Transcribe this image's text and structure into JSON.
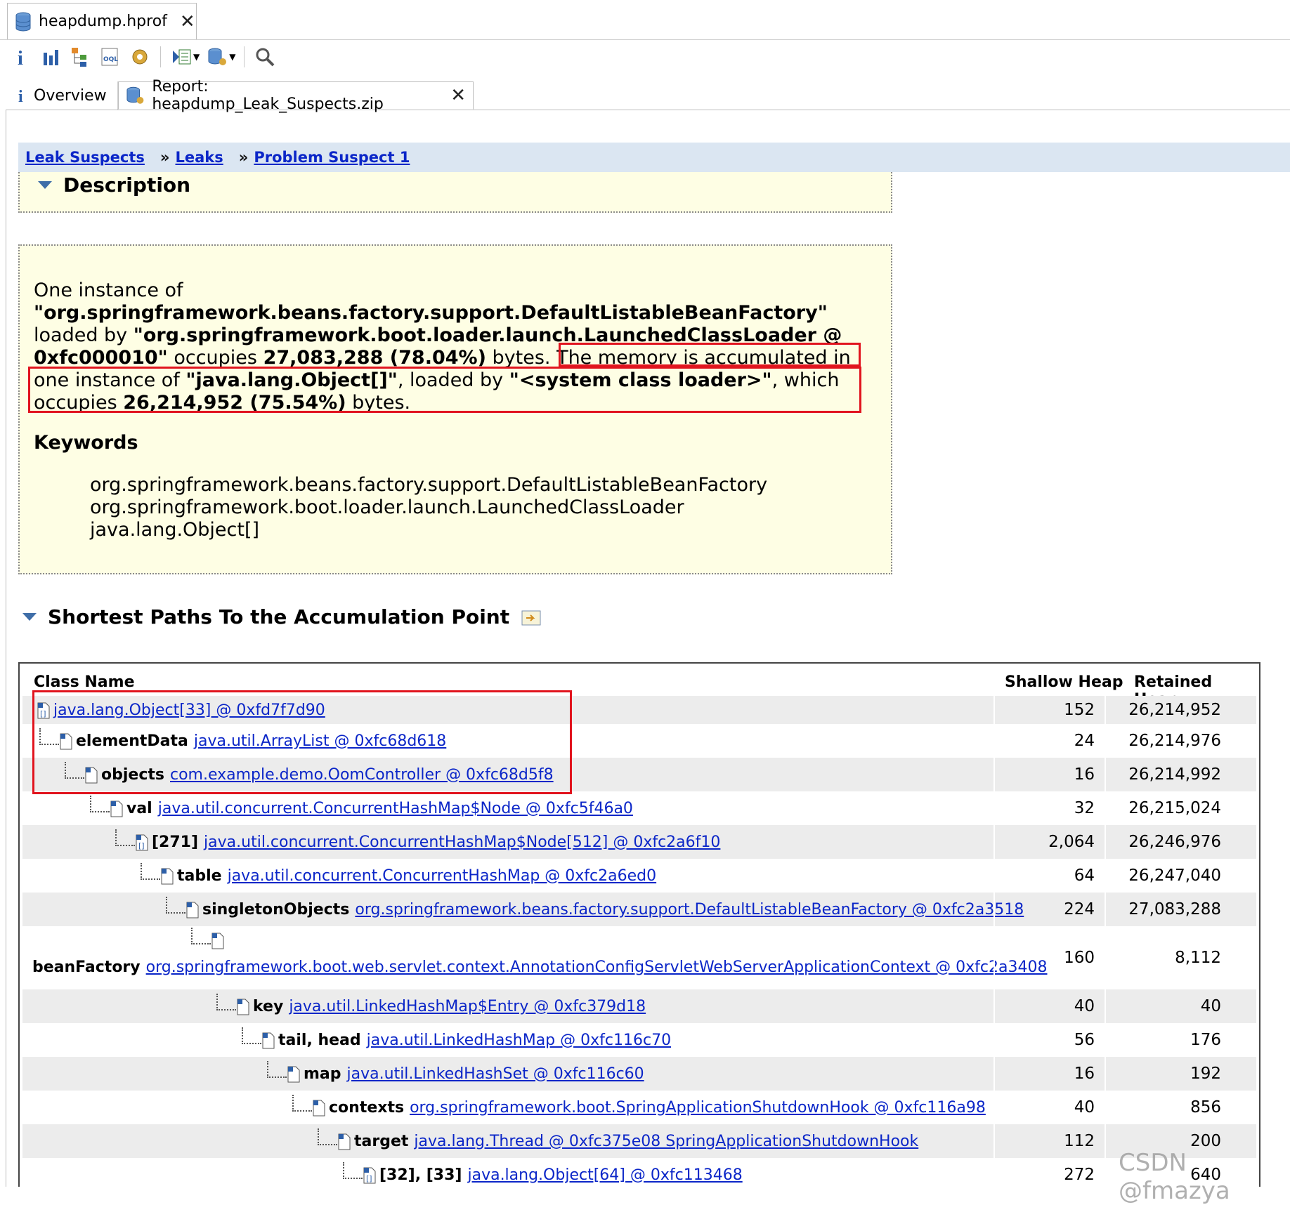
{
  "editor": {
    "tab_title": "heapdump.hprof"
  },
  "toolbar": {
    "icons": [
      "info-icon",
      "histogram-icon",
      "dominator-tree-icon",
      "oql-icon",
      "thread-overview-icon",
      "run-report-icon",
      "query-browser-icon",
      "find-object-icon"
    ]
  },
  "tabs": {
    "overview": "Overview",
    "report": "Report: heapdump_Leak_Suspects.zip"
  },
  "breadcrumb": {
    "items": [
      "Leak Suspects",
      "Leaks",
      "Problem Suspect 1"
    ],
    "separator": "»"
  },
  "description": {
    "heading": "Description",
    "p1": "One instance of",
    "class1": "\"org.springframework.beans.factory.support.DefaultListableBeanFactory\"",
    "loaded_by": "loaded by",
    "loader1": "\"org.springframework.boot.loader.launch.LaunchedClassLoader @",
    "loader1_addr": "0xfc000010\"",
    "occupies": "occupies",
    "size1": "27,083,288 (78.04%)",
    "bytes": "bytes.",
    "accum1": "The memory is accumulated in",
    "accum2": "one instance of",
    "class2": "\"java.lang.Object[]\"",
    "loaded_by2": ", loaded by",
    "loader2": "\"<system class loader>\"",
    "which": ", which",
    "occupies2": "occupies",
    "size2": "26,214,952 (75.54%)",
    "bytes2": "bytes.",
    "keywords_title": "Keywords",
    "keywords": [
      "org.springframework.beans.factory.support.DefaultListableBeanFactory",
      "org.springframework.boot.loader.launch.LaunchedClassLoader",
      "java.lang.Object[]"
    ]
  },
  "paths": {
    "heading": "Shortest Paths To the Accumulation Point",
    "columns": {
      "class_name": "Class Name",
      "shallow": "Shallow Heap",
      "retained": "Retained Heap"
    },
    "rows": [
      {
        "field": "",
        "link": "java.lang.Object[33] @ 0xfd7f7d90",
        "shallow": "152",
        "retained": "26,214,952"
      },
      {
        "field": "elementData",
        "link": "java.util.ArrayList @ 0xfc68d618",
        "shallow": "24",
        "retained": "26,214,976"
      },
      {
        "field": "objects",
        "link": "com.example.demo.OomController @ 0xfc68d5f8",
        "shallow": "16",
        "retained": "26,214,992"
      },
      {
        "field": "val",
        "link": "java.util.concurrent.ConcurrentHashMap$Node @ 0xfc5f46a0",
        "shallow": "32",
        "retained": "26,215,024"
      },
      {
        "field": "[271]",
        "link": "java.util.concurrent.ConcurrentHashMap$Node[512] @ 0xfc2a6f10",
        "shallow": "2,064",
        "retained": "26,246,976"
      },
      {
        "field": "table",
        "link": "java.util.concurrent.ConcurrentHashMap @ 0xfc2a6ed0",
        "shallow": "64",
        "retained": "26,247,040"
      },
      {
        "field": "singletonObjects",
        "link": "org.springframework.beans.factory.support.DefaultListableBeanFactory @ 0xfc2a3518",
        "shallow": "224",
        "retained": "27,083,288"
      },
      {
        "field": "beanFactory",
        "link": "org.springframework.boot.web.servlet.context.AnnotationConfigServletWebServerApplicationContext @ 0xfc2a3408",
        "shallow": "160",
        "retained": "8,112"
      },
      {
        "field": "key",
        "link": "java.util.LinkedHashMap$Entry @ 0xfc379d18",
        "shallow": "40",
        "retained": "40"
      },
      {
        "field": "tail, head",
        "link": "java.util.LinkedHashMap @ 0xfc116c70",
        "shallow": "56",
        "retained": "176"
      },
      {
        "field": "map",
        "link": "java.util.LinkedHashSet @ 0xfc116c60",
        "shallow": "16",
        "retained": "192"
      },
      {
        "field": "contexts",
        "link": "org.springframework.boot.SpringApplicationShutdownHook @ 0xfc116a98",
        "shallow": "40",
        "retained": "856"
      },
      {
        "field": "target",
        "link": "java.lang.Thread @ 0xfc375e08 SpringApplicationShutdownHook",
        "shallow": "112",
        "retained": "200"
      },
      {
        "field": "[32], [33]",
        "link": "java.lang.Object[64] @ 0xfc113468",
        "shallow": "272",
        "retained": "640"
      }
    ]
  },
  "watermark": "CSDN @fmazya",
  "colors": {
    "link": "#0b26c8",
    "highlight": "#e1141e",
    "yellow": "#fefee4",
    "breadcrumb_bg": "#dbe6f2"
  }
}
